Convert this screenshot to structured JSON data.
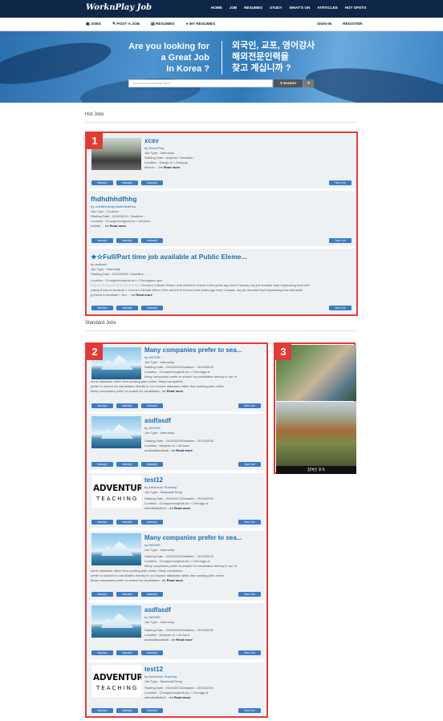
{
  "header": {
    "logo": "WorknPlay Job",
    "nav": [
      "HOME",
      "JOB",
      "RESUMES",
      "STUDY",
      "WHAT'S ON",
      "ATRTICLES",
      "HOT SPOTS"
    ],
    "subnav": [
      "JOBS",
      "POST A JOB",
      "RESUMES",
      "MY RESUMES"
    ],
    "account": [
      "SIGN-IN",
      "REGISTER"
    ]
  },
  "banner": {
    "en_line1": "Are you looking for",
    "en_line2": "a Great Job",
    "en_line3": "In Korea ?",
    "ko_line1": "외국인, 교포, 영어강사",
    "ko_line2": "해외전문인력을",
    "ko_line3": "찾고 계십니까 ?",
    "search_placeholder": "Search the knowledge Base...",
    "search_button": "SEARCH"
  },
  "hot_jobs": {
    "heading": "Hot Jobs",
    "badge": "1",
    "items": [
      {
        "title": "xcsv",
        "company": "WorknPlay",
        "job_type": "Job Type : Internship",
        "dates": "Starting Date : Anytime   /   Deadline :",
        "location": "Location : Daegu-si > Dong-gu",
        "desc": "dsvsdv ...",
        "more": ">> Read more",
        "tags": [
          "Industry1",
          "Industry2",
          "Industry3"
        ],
        "save": "Save Job"
      },
      {
        "title": "fhdhdhhdfhhg",
        "company": "dvbfdfhhdhdjhdhdfhdfhdfhbd",
        "job_type": "Job Type : Contract",
        "dates": "Starting Date : 2015/02/11   /   Deadline :",
        "location": "Location : Chungcheongbuk-do > All Area",
        "desc": "hbfdhd ...",
        "more": ">> Read more",
        "tags": [
          "Industry1",
          "Industry2",
          "Industry3"
        ],
        "save": "Save Job"
      },
      {
        "title": "★☆Full/Part time job available at Public Eleme...",
        "company": "asdfsadf",
        "job_type": "Job Type : Internship",
        "dates": "Starting Date : 2015/02/05   /   Deadline :",
        "location": "Location : Chungcheongbuk-do > Cheongwon-gun",
        "desc1": "☆☆☆☆☆☆☆☆☆☆☆☆☆☆☆☆☆☆Korea's Climate When I first arrived in Korea a few years ago from Canada, my job recruiter kept expressing how inter",
        "desc2": "esting Korea is because I..Korea's Climate When I first arrived in Korea a few years ago from Canada, my job recruiter kept expressing how interestin",
        "desc3": "g Korea is because I..Kor ...",
        "more": ">> Read more",
        "tags": [
          "Industry1",
          "Industry2",
          "Industry3"
        ],
        "save": "Save Job"
      }
    ]
  },
  "standard_jobs": {
    "heading": "Standard Jobs",
    "badge": "2",
    "items": [
      {
        "title": "Many companies prefer to sea...",
        "company": "WESRE",
        "job_type": "Job Type : Internship",
        "dates": "Starting Date : 2015/02/04Deadline : 2015/02/28",
        "location": "Location : Chungcheongbuk-do > Cheongju-si",
        "desc1": "Many companies prefer to search for candidates directly in our re",
        "desc2": "sume database rather than posting jobs online. Many companies",
        "desc3": "prefer to search for candidates directly in our resume database rather than posting jobs online.",
        "desc4": "Many companies prefer to search for candidates...",
        "more": ">> Read more",
        "tags": [
          "Industry1",
          "Industry2",
          "Industry3"
        ],
        "save": "Save Job"
      },
      {
        "title": "asdfasdf",
        "company": "WESRE",
        "job_type": "Job Type : Internship",
        "dates": "Starting Date : 2015/02/05Deadline : 2015/02/26",
        "location": "Location : Daejeon-si > All Area",
        "desc1": "asdfasdfasdfasdf...",
        "more": ">> Read more",
        "tags": [
          "Industry1",
          "Industry2",
          "Industry3"
        ],
        "save": "Save Job"
      },
      {
        "title": "test12",
        "company": "Adventure Teaching",
        "job_type": "Job Type : Seasonal/Temp",
        "dates": "Starting Date : 2015/02/13Deadline : 2015/02/09",
        "location": "Location : Chungcheongbuk-do > Chungju-si",
        "desc1": "sdfsdfsdfsdfsdf ...",
        "more": ">> Read more",
        "tags": [
          "Industry1",
          "Industry2",
          "Industry3"
        ],
        "save": "Save Job"
      },
      {
        "title": "Many companies prefer to sea...",
        "company": "WESRE",
        "job_type": "Job Type : Internship",
        "dates": "Starting Date : 2015/02/04Deadline : 2015/02/28",
        "location": "Location : Chungcheongbuk-do > Cheongju-si",
        "desc1": "Many companies prefer to search for candidates directly in our re",
        "desc2": "sume database rather than posting jobs online. Many companies",
        "desc3": "prefer to search for candidates directly in our resume database rather than posting jobs online.",
        "desc4": "Many companies prefer to search for candidates...",
        "more": ">> Read more",
        "tags": [
          "Industry1",
          "Industry2",
          "Industry3"
        ],
        "save": "Save Job"
      },
      {
        "title": "asdfasdf",
        "company": "WESRE",
        "job_type": "Job Type : Internship",
        "dates": "Starting Date : 2015/02/05Deadline : 2015/02/26",
        "location": "Location : Daejeon-si > All Area",
        "desc1": "asdfasdfasdfasdf...",
        "more": ">> Read more",
        "tags": [
          "Industry1",
          "Industry2",
          "Industry3"
        ],
        "save": "Save Job"
      },
      {
        "title": "test12",
        "company": "Adventure Teaching",
        "job_type": "Job Type : Seasonal/Temp",
        "dates": "Starting Date : 2015/02/13Deadline : 2015/02/09",
        "location": "Location : Chungcheongbuk-do > Chungju-si",
        "desc1": "sdfsdfsdfsdfsdf ...",
        "more": ">> Read more",
        "tags": [
          "Industry1",
          "Industry2",
          "Industry3"
        ],
        "save": "Save Job"
      }
    ]
  },
  "sidebar": {
    "badge": "3",
    "caption": "참여인 후속"
  },
  "adventure_logo": {
    "word1": "ADVENTURE",
    "word2": "TEACHING"
  },
  "colors": {
    "navy": "#0e2748",
    "accent": "#e53935",
    "link": "#1d6fb0",
    "button": "#3d7bc7"
  }
}
